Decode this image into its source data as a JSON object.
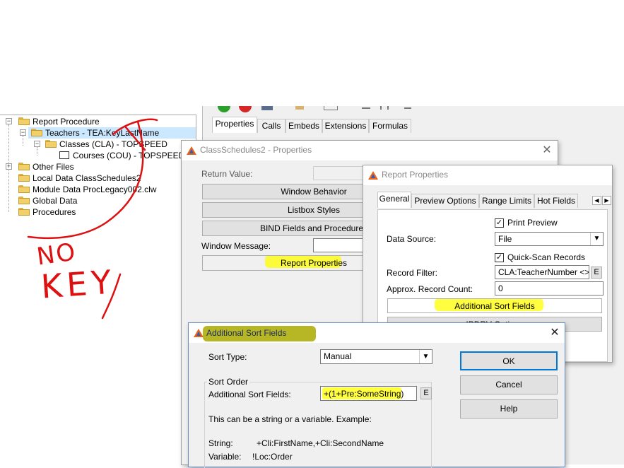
{
  "tree": {
    "items": [
      {
        "label": "Report Procedure",
        "expander": "−"
      },
      {
        "label": "Teachers - TEA:KeyLastName",
        "expander": "−"
      },
      {
        "label": "Classes (CLA) - TOPSPEED",
        "expander": "−"
      },
      {
        "label": "Courses (COU) - TOPSPEED"
      },
      {
        "label": "Other Files",
        "expander": "+"
      },
      {
        "label": "Local Data ClassSchedules2"
      },
      {
        "label": "Module Data ProcLegacy002.clw"
      },
      {
        "label": "Global Data"
      },
      {
        "label": "Procedures"
      }
    ]
  },
  "annotation": {
    "line1": "NO",
    "line2": "KEY",
    "color": "#dd1111"
  },
  "main_tabs": [
    "Properties",
    "Calls",
    "Embeds",
    "Extensions",
    "Formulas"
  ],
  "class_schedules": {
    "title": "ClassSchedules2 - Properties",
    "return_value_label": "Return Value:",
    "window_behavior": "Window Behavior",
    "listbox_styles": "Listbox Styles",
    "bind_fields": "BIND Fields and Procedures",
    "window_message_label": "Window Message:",
    "report_properties": "Report Properties"
  },
  "report_properties": {
    "title": "Report Properties",
    "tabs": [
      "General",
      "Preview Options",
      "Range Limits",
      "Hot Fields"
    ],
    "print_preview": "Print Preview",
    "data_source_label": "Data Source:",
    "data_source_value": "File",
    "quick_scan": "Quick-Scan Records",
    "record_filter_label": "Record Filter:",
    "record_filter_value": "CLA:TeacherNumber <>",
    "approx_count_label": "Approx. Record Count:",
    "approx_count_value": "0",
    "additional_sort_fields": "Additional Sort Fields",
    "e_label": "E",
    "cut_button": "IPDRV Options"
  },
  "sort_dialog": {
    "title": "Additional Sort Fields",
    "sort_type_label": "Sort Type:",
    "sort_type_value": "Manual",
    "sort_order_label": "Sort Order",
    "additional_label": "Additional Sort Fields:",
    "additional_value": "+(1+Pre:SomeString)",
    "e_label": "E",
    "help_text": "This can be a string or a variable.  Example:",
    "string_label": "String:",
    "string_example": "+Cli:FirstName,+Cli:SecondName",
    "variable_label": "Variable:",
    "variable_example": "!Loc:Order",
    "ok": "OK",
    "cancel": "Cancel",
    "help": "Help"
  },
  "colors": {
    "highlight": "#ffff00",
    "accent_title": "#2b5fb8",
    "focus_border": "#0078d7"
  }
}
